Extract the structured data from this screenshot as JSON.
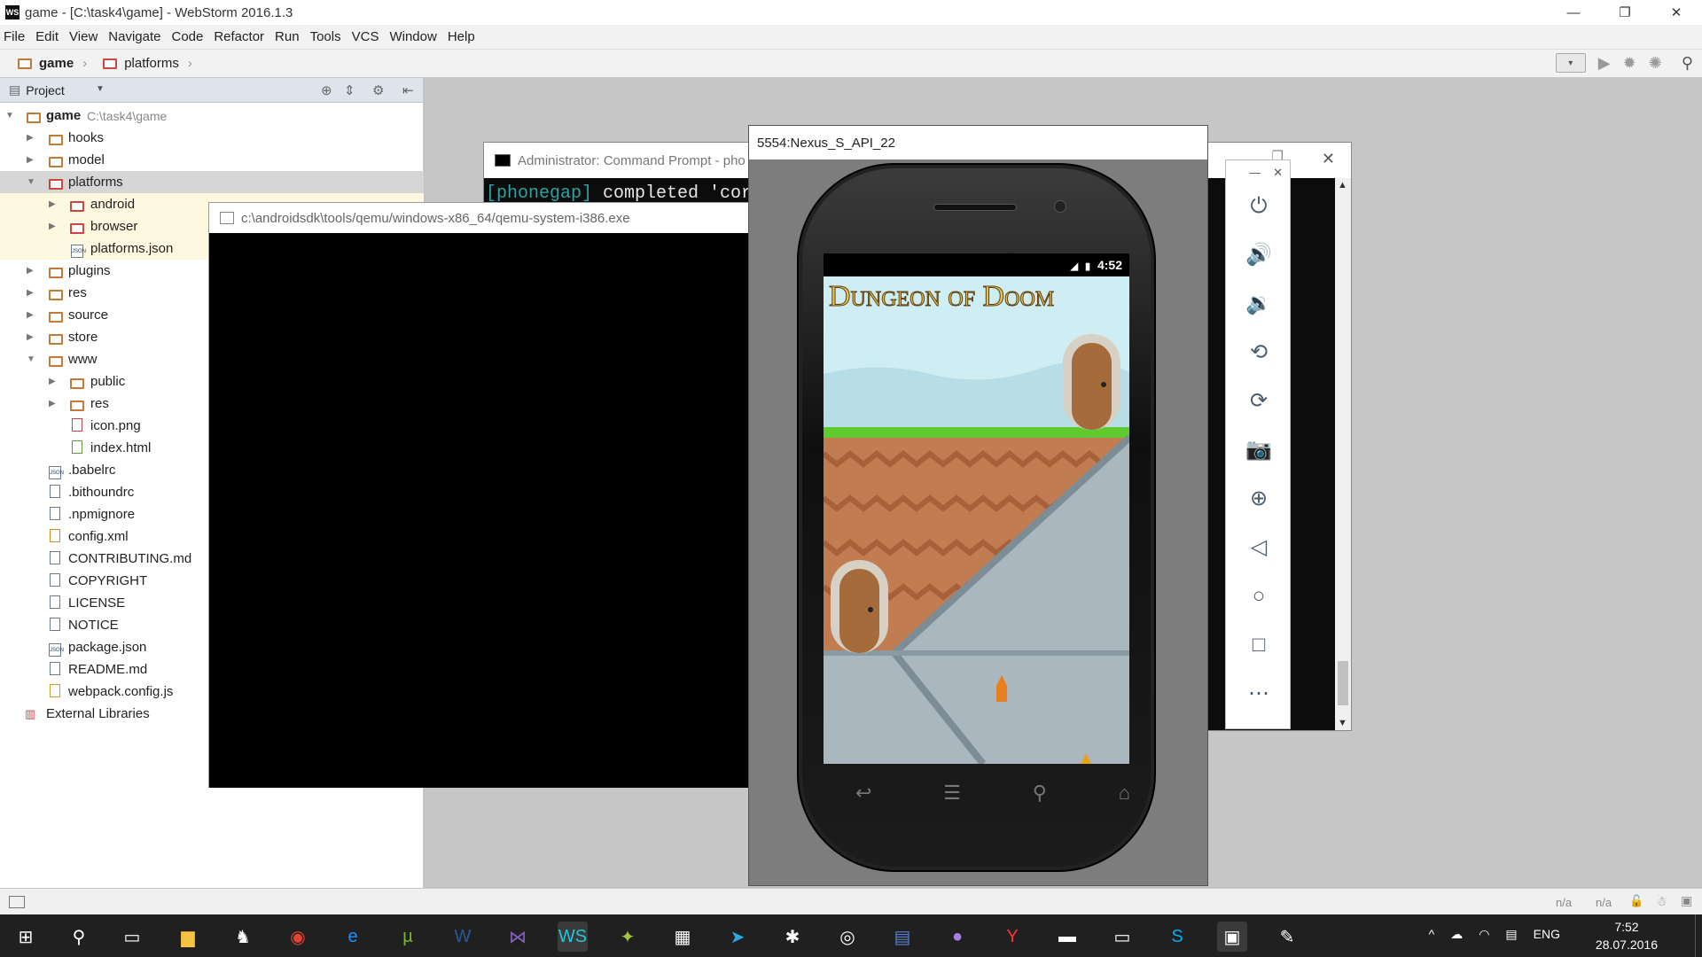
{
  "window": {
    "title": "game - [C:\\task4\\game] - WebStorm 2016.1.3"
  },
  "menu": [
    "File",
    "Edit",
    "View",
    "Navigate",
    "Code",
    "Refactor",
    "Run",
    "Tools",
    "VCS",
    "Window",
    "Help"
  ],
  "breadcrumb": {
    "root": "game",
    "child": "platforms"
  },
  "project_panel": {
    "header": "Project",
    "root_name": "game",
    "root_path": "C:\\task4\\game",
    "items": [
      {
        "label": "hooks"
      },
      {
        "label": "model"
      },
      {
        "label": "platforms"
      },
      {
        "label": "android"
      },
      {
        "label": "browser"
      },
      {
        "label": "platforms.json"
      },
      {
        "label": "plugins"
      },
      {
        "label": "res"
      },
      {
        "label": "source"
      },
      {
        "label": "store"
      },
      {
        "label": "www"
      },
      {
        "label": "public"
      },
      {
        "label": "res"
      },
      {
        "label": "icon.png"
      },
      {
        "label": "index.html"
      },
      {
        "label": ".babelrc"
      },
      {
        "label": ".bithoundrc"
      },
      {
        "label": ".npmignore"
      },
      {
        "label": "config.xml"
      },
      {
        "label": "CONTRIBUTING.md"
      },
      {
        "label": "COPYRIGHT"
      },
      {
        "label": "LICENSE"
      },
      {
        "label": "NOTICE"
      },
      {
        "label": "package.json"
      },
      {
        "label": "README.md"
      },
      {
        "label": "webpack.config.js"
      },
      {
        "label": "External Libraries"
      }
    ]
  },
  "cmd": {
    "title": "Administrator: Command Prompt - pho",
    "line_tag": "[phonegap]",
    "line_text": " completed 'cor"
  },
  "qemu": {
    "title": "c:\\androidsdk\\tools/qemu/windows-x86_64/qemu-system-i386.exe"
  },
  "emulator": {
    "title": "5554:Nexus_S_API_22",
    "time": "4:52",
    "game_title": "Dungeon of Doom"
  },
  "status": {
    "na1": "n/a",
    "na2": "n/a"
  },
  "taskbar": {
    "lang": "ENG",
    "time": "7:52",
    "date": "28.07.2016"
  }
}
